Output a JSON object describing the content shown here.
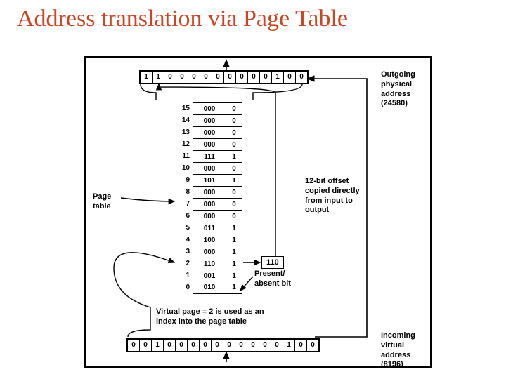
{
  "title": "Address translation via Page Table",
  "outgoing_bits": [
    "1",
    "1",
    "0",
    "0",
    "0",
    "0",
    "0",
    "0",
    "0",
    "0",
    "0",
    "1",
    "0",
    "0"
  ],
  "incoming_bits": [
    "0",
    "0",
    "1",
    "0",
    "0",
    "0",
    "0",
    "0",
    "0",
    "0",
    "0",
    "0",
    "0",
    "1",
    "0",
    "0"
  ],
  "page_table": [
    {
      "idx": "15",
      "frame": "000",
      "present": "0"
    },
    {
      "idx": "14",
      "frame": "000",
      "present": "0"
    },
    {
      "idx": "13",
      "frame": "000",
      "present": "0"
    },
    {
      "idx": "12",
      "frame": "000",
      "present": "0"
    },
    {
      "idx": "11",
      "frame": "111",
      "present": "1"
    },
    {
      "idx": "10",
      "frame": "000",
      "present": "0"
    },
    {
      "idx": "9",
      "frame": "101",
      "present": "1"
    },
    {
      "idx": "8",
      "frame": "000",
      "present": "0"
    },
    {
      "idx": "7",
      "frame": "000",
      "present": "0"
    },
    {
      "idx": "6",
      "frame": "000",
      "present": "0"
    },
    {
      "idx": "5",
      "frame": "011",
      "present": "1"
    },
    {
      "idx": "4",
      "frame": "100",
      "present": "1"
    },
    {
      "idx": "3",
      "frame": "000",
      "present": "1"
    },
    {
      "idx": "2",
      "frame": "110",
      "present": "1"
    },
    {
      "idx": "1",
      "frame": "001",
      "present": "1"
    },
    {
      "idx": "0",
      "frame": "010",
      "present": "1"
    }
  ],
  "labels": {
    "outgoing": "Outgoing physical address (24580)",
    "incoming": "Incoming virtual address (8196)",
    "page_table": "Page table",
    "offset": "12-bit offset copied directly from input to output",
    "index_note": "Virtual page = 2 is used as an index into the page table",
    "present_note": "Present/ absent bit",
    "lookup_value": "110"
  }
}
